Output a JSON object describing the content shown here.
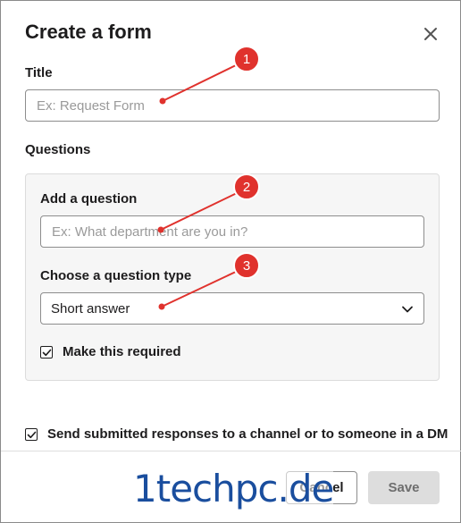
{
  "dialog": {
    "title": "Create a form",
    "title_field": {
      "label": "Title",
      "placeholder": "Ex: Request Form",
      "value": ""
    },
    "questions_heading": "Questions",
    "question_panel": {
      "question_label": "Add a question",
      "question_placeholder": "Ex: What department are you in?",
      "type_label": "Choose a question type",
      "type_value": "Short answer",
      "required_label": "Make this required",
      "required_checked": true
    },
    "send_responses_label": "Send submitted responses to a channel or to someone in a DM",
    "send_responses_checked": true,
    "cancel_label": "Cancel",
    "save_label": "Save"
  },
  "annotations": {
    "color": "#e0322d",
    "markers": [
      "1",
      "2",
      "3"
    ]
  },
  "watermark": "1techpc.de",
  "icons": {
    "close": "close-icon",
    "chevron": "chevron-down-icon",
    "check": "checkmark-icon"
  }
}
